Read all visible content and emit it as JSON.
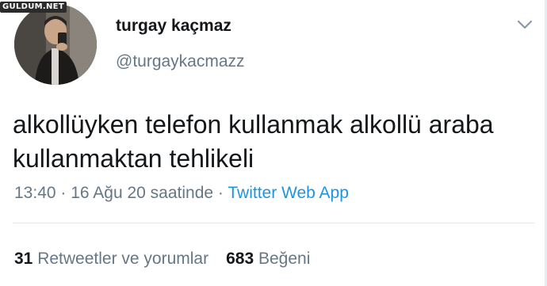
{
  "watermark": "GULDUM.NET",
  "user": {
    "display_name": "turgay kaçmaz",
    "handle": "@turgaykacmazz"
  },
  "icons": {
    "menu": "chevron-down-icon",
    "avatar": "profile-photo"
  },
  "tweet": {
    "line1": "alkollüyken telefon kullanmak alkollü araba",
    "line2": "kullanmaktan tehlikeli"
  },
  "meta": {
    "time": "13:40",
    "separator1": " · ",
    "date": "16 Ağu 20 saatinde",
    "separator2": " · ",
    "source": "Twitter Web App"
  },
  "stats": {
    "retweets_count": "31",
    "retweets_label": "Retweetler ve yorumlar",
    "likes_count": "683",
    "likes_label": "Beğeni"
  },
  "colors": {
    "text": "#14171a",
    "muted": "#657786",
    "link": "#1b95e0",
    "divider": "#e1e8ed"
  }
}
